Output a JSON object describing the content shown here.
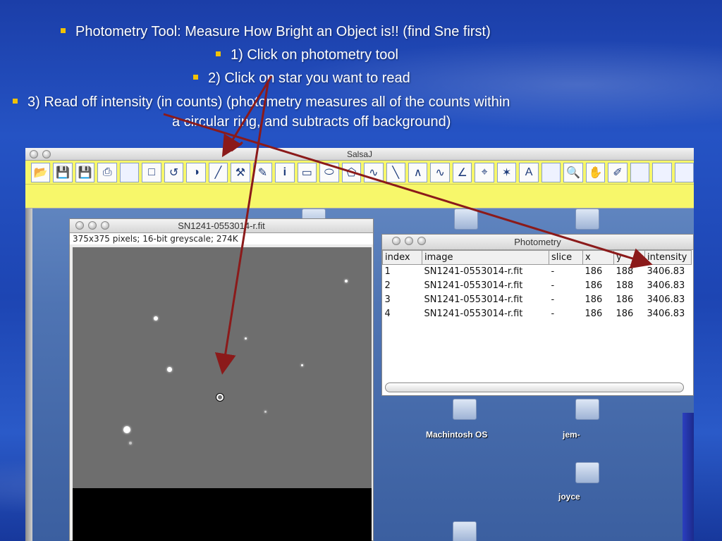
{
  "bullets": [
    "Photometry Tool: Measure How Bright an Object is!! (find Sne first)",
    "1)  Click on photometry tool",
    "2)  Click on star you want to read",
    "3)  Read off intensity (in counts) (photometry measures all of the counts within",
    "a circular ring, and subtracts off background)"
  ],
  "app": {
    "title": "SalsaJ"
  },
  "toolbar_icons": [
    "open-icon",
    "save-icon",
    "save-as-icon",
    "print-icon",
    "blank",
    "rectangle-select-icon",
    "undo-icon",
    "contrast-icon",
    "photometry-wand-icon",
    "settings-wrench-icon",
    "paint-icon",
    "info-icon",
    "rectangle-icon",
    "oval-icon",
    "polygon-icon",
    "freehand-icon",
    "line-icon",
    "segmented-line-icon",
    "freehand-line-icon",
    "angle-icon",
    "crosshair-icon",
    "wand-icon",
    "text-icon",
    "blank",
    "zoom-icon",
    "hand-icon",
    "dropper-icon",
    "blank",
    "blank",
    "blank"
  ],
  "text_tool_glyph": "A",
  "info_tool_glyph": "i",
  "image_window": {
    "title": "SN1241-0553014-r.fit",
    "info": "375x375 pixels; 16-bit greyscale; 274K"
  },
  "photometry": {
    "title": "Photometry",
    "columns": [
      "index",
      "image",
      "slice",
      "x",
      "y",
      "intensity"
    ],
    "rows": [
      [
        "1",
        "SN1241-0553014-r.fit",
        "-",
        "186",
        "188",
        "3406.83"
      ],
      [
        "2",
        "SN1241-0553014-r.fit",
        "-",
        "186",
        "188",
        "3406.83"
      ],
      [
        "3",
        "SN1241-0553014-r.fit",
        "-",
        "186",
        "186",
        "3406.83"
      ],
      [
        "4",
        "SN1241-0553014-r.fit",
        "-",
        "186",
        "186",
        "3406.83"
      ]
    ]
  },
  "desktop_labels": [
    "Machintosh OS",
    "jem-",
    "joyce"
  ],
  "colors": {
    "bullet": "#f2c200",
    "arrow": "#8b1a1a",
    "toolbar": "#f7f76a"
  }
}
